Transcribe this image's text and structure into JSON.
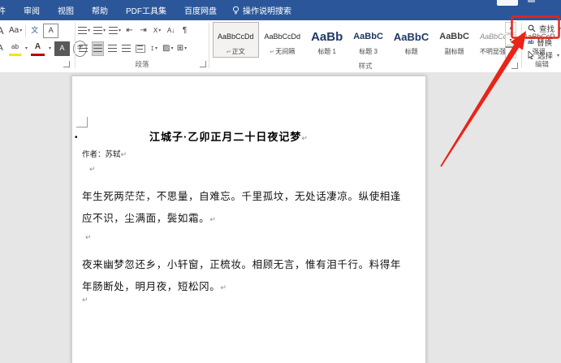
{
  "colors": {
    "title_bar_blue": "#2b579a",
    "annotation_red": "#e82418",
    "page_bg": "#e6e6e6"
  },
  "menu_bar": {
    "partial_tab": "件",
    "tabs": [
      "审阅",
      "视图",
      "帮助",
      "PDF工具集",
      "百度网盘"
    ],
    "tell_me": "操作说明搜索"
  },
  "ribbon": {
    "font_group": {
      "grow_font": "A",
      "change_case": "Aa",
      "phonetic_guide": "文",
      "char_border": "A",
      "text_effects": "A",
      "text_highlight": "ab",
      "font_color": "A",
      "char_shading": "A",
      "enclose_char": "字",
      "caret": "▾"
    },
    "paragraph_group": {
      "label": "段落",
      "dec_indent": "⇤",
      "inc_indent": "⇥",
      "asian_layout": "X",
      "sort": "A↓",
      "show_marks": "¶",
      "line_spacing": "↕",
      "shading": "▨",
      "borders": "⊞",
      "caret": "▾"
    },
    "styles_group": {
      "label": "样式",
      "return_mark": "↵",
      "scroll_up": "▴",
      "scroll_down": "▾",
      "scroll_more": "▾",
      "items": [
        {
          "preview": "AaBbCcDd",
          "label": "正文"
        },
        {
          "preview": "AaBbCcDd",
          "label": "无间隔"
        },
        {
          "preview": "AaBb",
          "label": "标题 1"
        },
        {
          "preview": "AaBbC",
          "label": "标题 3"
        },
        {
          "preview": "AaBbC",
          "label": "标题"
        },
        {
          "preview": "AaBbC",
          "label": "副标题"
        },
        {
          "preview": "AaBbCcD",
          "label": "不明显强调"
        },
        {
          "preview": "AaBbCcD",
          "label": "强调"
        }
      ]
    },
    "editing_group": {
      "label": "编辑",
      "find": "查找",
      "replace": "替换",
      "select": "选择",
      "replace_icon": "ab",
      "caret": "▾"
    }
  },
  "document": {
    "bullet": "•",
    "title": "江城子·乙卯正月二十日夜记梦",
    "author": "作者：苏轼",
    "pilcrow": "↵",
    "para1_line1": "年生死两茫茫，不思量，自难忘。千里孤坟，无处话凄凉。纵使相逢",
    "para1_line2": "应不识，尘满面，鬓如霜。",
    "para2_line1": "夜来幽梦忽还乡，小轩窗，正梳妆。相顾无言，惟有泪千行。料得年",
    "para2_line2": "年肠断处，明月夜，短松冈。"
  }
}
